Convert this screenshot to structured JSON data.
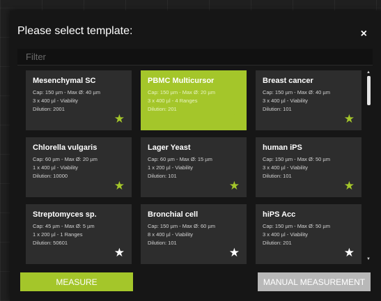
{
  "dialog": {
    "title": "Please select template:",
    "close_label": "×",
    "filter_placeholder": "Filter"
  },
  "templates": [
    {
      "name": "Mesenchymal SC",
      "cap": "Cap: 150 µm - Max Ø: 40 µm",
      "volume": "3 x 400 µl - Viability",
      "dilution": "Dilution: 2001",
      "star": "green",
      "selected": false
    },
    {
      "name": "PBMC Multicursor",
      "cap": "Cap: 150 µm - Max Ø: 20 µm",
      "volume": "3 x 400 µl - 4 Ranges",
      "dilution": "Dilution: 201",
      "star": "green",
      "selected": true
    },
    {
      "name": "Breast cancer",
      "cap": "Cap: 150 µm - Max Ø: 40 µm",
      "volume": "3 x 400 µl - Viability",
      "dilution": "Dilution: 101",
      "star": "green",
      "selected": false
    },
    {
      "name": "Chlorella vulgaris",
      "cap": "Cap: 60 µm - Max Ø: 20 µm",
      "volume": "1 x 400 µl - Viability",
      "dilution": "Dilution: 10000",
      "star": "green",
      "selected": false
    },
    {
      "name": "Lager Yeast",
      "cap": "Cap: 60 µm - Max Ø: 15 µm",
      "volume": "1 x 200 µl - Viability",
      "dilution": "Dilution: 101",
      "star": "green",
      "selected": false
    },
    {
      "name": "human iPS",
      "cap": "Cap: 150 µm - Max Ø: 50 µm",
      "volume": "3 x 400 µl - Viability",
      "dilution": "Dilution: 101",
      "star": "green",
      "selected": false
    },
    {
      "name": "Streptomyces sp.",
      "cap": "Cap: 45 µm - Max Ø: 5 µm",
      "volume": "1 x 200 µl - 1 Ranges",
      "dilution": "Dilution: 50601",
      "star": "white",
      "selected": false
    },
    {
      "name": "Bronchial cell",
      "cap": "Cap: 150 µm - Max Ø: 60 µm",
      "volume": "8 x 400 µl - Viability",
      "dilution": "Dilution: 101",
      "star": "white",
      "selected": false
    },
    {
      "name": "hiPS Acc",
      "cap": "Cap: 150 µm - Max Ø: 50 µm",
      "volume": "3 x 400 µl - Viability",
      "dilution": "Dilution: 201",
      "star": "white",
      "selected": false
    }
  ],
  "icons": {
    "star": "star-icon",
    "close": "close-icon",
    "scroll_up": "chevron-up-icon",
    "scroll_down": "chevron-down-icon"
  },
  "colors": {
    "accent": "#a4c62a",
    "card": "#2d2d2d",
    "dialog": "#161616",
    "secondary_button": "#b8b8b8"
  },
  "buttons": {
    "measure": "MEASURE",
    "manual": "MANUAL MEASUREMENT"
  },
  "scroll": {
    "up": "▲",
    "down": "▼"
  }
}
